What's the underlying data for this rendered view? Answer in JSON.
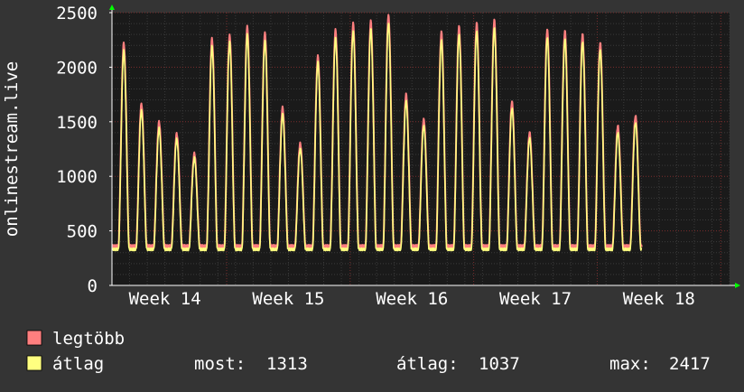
{
  "chart_data": {
    "type": "line",
    "ylabel": "onlinestream.live",
    "ylim": [
      0,
      2500
    ],
    "yticks": [
      0,
      500,
      1000,
      1500,
      2000,
      2500
    ],
    "xticks": [
      "Week 14",
      "Week 15",
      "Week 16",
      "Week 17",
      "Week 18"
    ],
    "grid": true,
    "x_units": "days",
    "x_range": [
      -3,
      32
    ],
    "xtick_positions": [
      0,
      7,
      14,
      21,
      28
    ],
    "series": [
      {
        "name": "legtöbb",
        "color": "#ff7f7f",
        "daily_peaks": [
          2220,
          1660,
          1500,
          1390,
          1210,
          2260,
          2290,
          2370,
          2310,
          1630,
          1300,
          2100,
          2340,
          2400,
          2420,
          2470,
          1750,
          1520,
          2320,
          2370,
          2400,
          2430,
          1680,
          1400,
          2340,
          2330,
          2300,
          2220,
          1460,
          1550
        ],
        "trough": 360
      },
      {
        "name": "átlag",
        "color": "#ffff80",
        "daily_peaks": [
          2150,
          1600,
          1440,
          1340,
          1170,
          2190,
          2230,
          2300,
          2240,
          1570,
          1250,
          2050,
          2270,
          2330,
          2350,
          2400,
          1690,
          1460,
          2250,
          2300,
          2330,
          2360,
          1620,
          1350,
          2270,
          2260,
          2230,
          2160,
          1400,
          1490
        ],
        "trough": 330
      }
    ]
  },
  "legend": {
    "items": [
      {
        "label": "legtöbb",
        "color": "#ff7f7f"
      },
      {
        "label": "átlag",
        "color": "#ffff80"
      }
    ],
    "stats": {
      "now_label": "most:",
      "now_value": "1313",
      "avg_label": "átlag:",
      "avg_value": "1037",
      "max_label": "max:",
      "max_value": "2417"
    }
  },
  "colors": {
    "background": "#343434",
    "plot_background": "#1a1a1a",
    "grid_minor": "#3a3a3a",
    "grid_major": "#7a2d2d",
    "arrow": "#00ff00"
  }
}
